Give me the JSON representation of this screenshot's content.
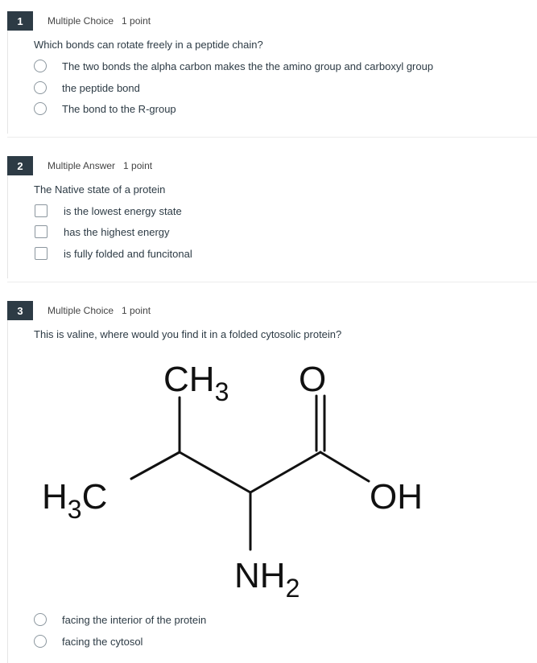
{
  "questions": [
    {
      "number": "1",
      "type": "Multiple Choice",
      "points": "1 point",
      "text": "Which bonds can rotate freely in a peptide chain?",
      "options": [
        "The two bonds the alpha carbon makes the the amino group and carboxyl group",
        "the peptide bond",
        "The bond to the R-group"
      ]
    },
    {
      "number": "2",
      "type": "Multiple Answer",
      "points": "1 point",
      "text": "The Native state of a protein",
      "options": [
        "is the lowest energy state",
        "has the highest energy",
        "is fully folded and funcitonal"
      ]
    },
    {
      "number": "3",
      "type": "Multiple Choice",
      "points": "1 point",
      "text": "This is valine, where would you find it in a folded cytosolic protein?",
      "structure_labels": {
        "ch3_main": "CH",
        "ch3_sub": "3",
        "o": "O",
        "h3c_h": "H",
        "h3c_sub": "3",
        "h3c_c": "C",
        "oh": "OH",
        "nh2_main": "NH",
        "nh2_sub": "2"
      },
      "options": [
        "facing the interior of the protein",
        "facing the cytosol"
      ]
    }
  ]
}
